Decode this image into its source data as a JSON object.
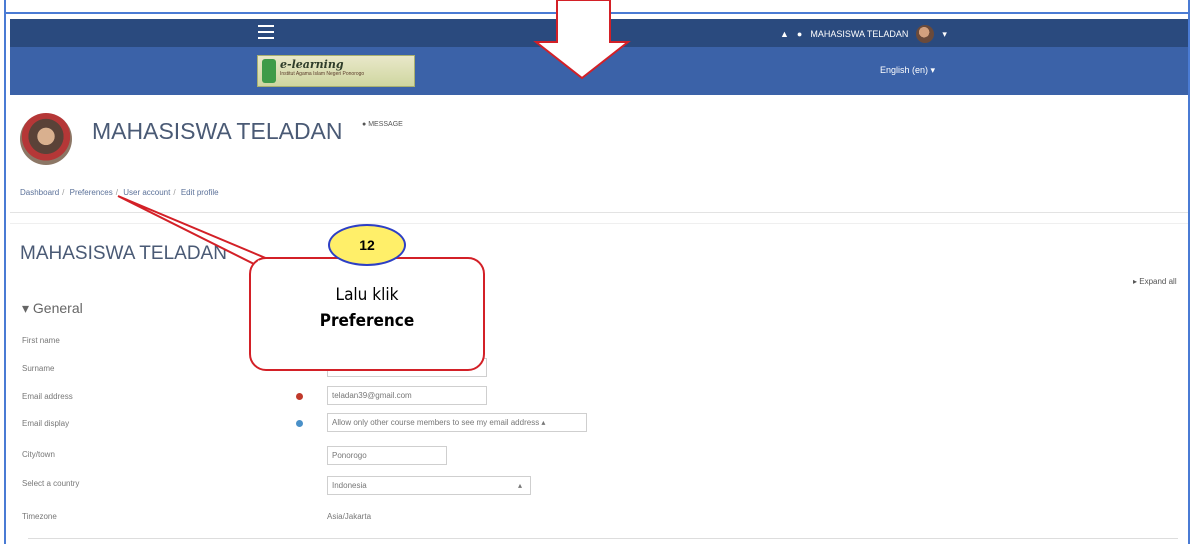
{
  "navbar": {
    "user_name": "MAHASISWA TELADAN",
    "icons": [
      "bell-icon",
      "chat-icon",
      "hamburger-icon"
    ]
  },
  "banner": {
    "logo_title": "e-learning",
    "logo_subtitle": "Institut Agama Islam Negeri Ponorogo",
    "language": "English (en) ▾"
  },
  "profile": {
    "name": "MAHASISWA TELADAN",
    "message_link": "MESSAGE"
  },
  "breadcrumb": [
    "Dashboard",
    "Preferences",
    "User account",
    "Edit profile"
  ],
  "page": {
    "heading": "MAHASISWA TELADAN",
    "expand_all": "Expand all",
    "section": "General"
  },
  "form": {
    "first_name_label": "First name",
    "surname_label": "Surname",
    "email_label": "Email address",
    "email_value": "teladan39@gmail.com",
    "email_display_label": "Email display",
    "email_display_value": "Allow only other course members to see my email address",
    "city_label": "City/town",
    "city_value": "Ponorogo",
    "country_label": "Select a country",
    "country_value": "Indonesia",
    "timezone_label": "Timezone",
    "timezone_value": "Asia/Jakarta"
  },
  "callout": {
    "number": "12",
    "line1": "Lalu klik",
    "line2": "Preference"
  },
  "colors": {
    "navbar": "#2a4a7e",
    "banner": "#3b62a8",
    "callout_border": "#d32027",
    "badge_fill": "#ffef69",
    "badge_border": "#2d3fc5"
  }
}
